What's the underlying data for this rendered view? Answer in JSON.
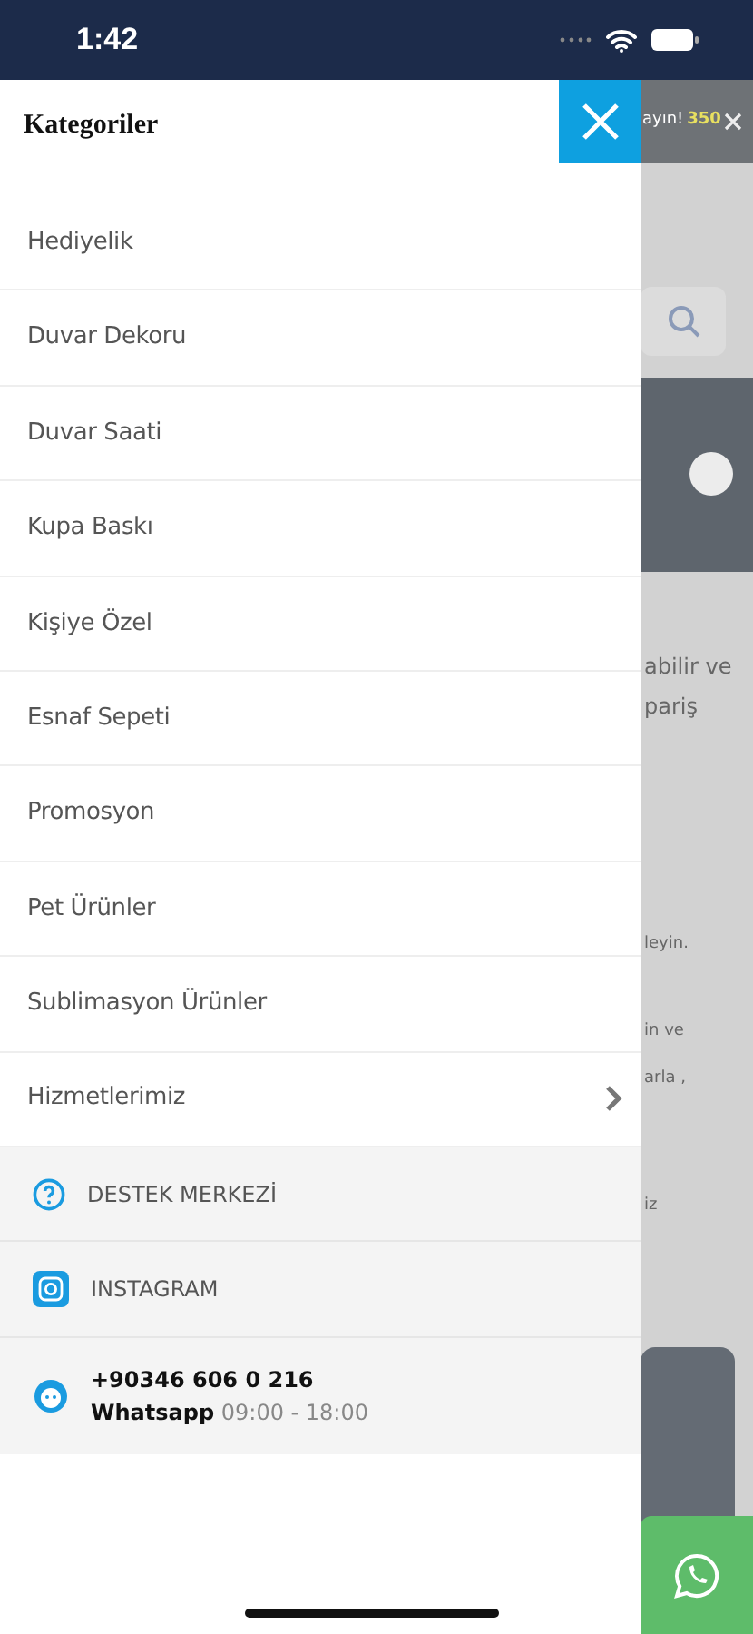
{
  "status_bar": {
    "time": "1:42"
  },
  "drawer": {
    "title": "Kategoriler",
    "items": [
      {
        "label": "Hediyelik",
        "kind": "link"
      },
      {
        "label": "Duvar Dekoru",
        "kind": "link"
      },
      {
        "label": "Duvar Saati",
        "kind": "link"
      },
      {
        "label": "Kupa Baskı",
        "kind": "link"
      },
      {
        "label": "Kişiye Özel",
        "kind": "link"
      },
      {
        "label": "Esnaf Sepeti",
        "kind": "link"
      },
      {
        "label": "Promosyon",
        "kind": "link"
      },
      {
        "label": "Pet Ürünler",
        "kind": "link"
      },
      {
        "label": "Sublimasyon Ürünler",
        "kind": "link"
      },
      {
        "label": "Hizmetlerimiz",
        "kind": "submenu"
      }
    ],
    "footer_links": [
      {
        "label": "DESTEK MERKEZİ",
        "kind": "help"
      },
      {
        "label": "INSTAGRAM",
        "kind": "instagram"
      }
    ],
    "contact": {
      "phone": "+90346 606 0 216",
      "channel": "Whatsapp",
      "hours": "09:00 - 18:00"
    }
  },
  "background_page": {
    "banner_text": "ayın!",
    "banner_count": "350",
    "texts": [
      "abilir ve",
      "pariş",
      "leyin.",
      "in ve",
      "arla ,",
      "iz"
    ]
  }
}
